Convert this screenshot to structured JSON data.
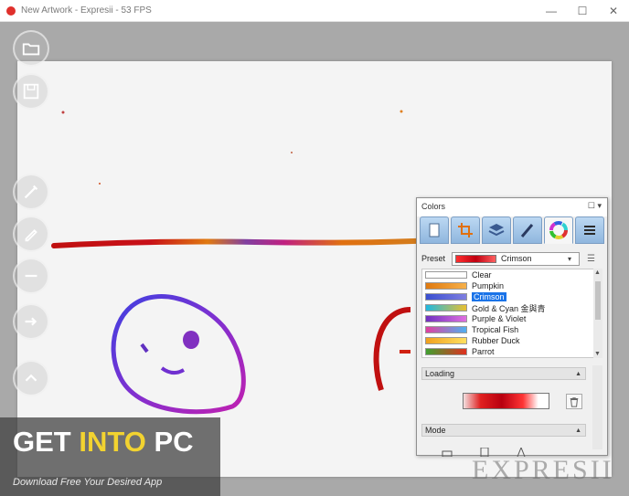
{
  "window": {
    "title": "New Artwork - Expresii - 53 FPS",
    "minimize_glyph": "—",
    "maximize_glyph": "☐",
    "close_glyph": "✕"
  },
  "tools": [
    {
      "name": "open-folder-icon"
    },
    {
      "name": "save-icon"
    },
    {
      "name": "brush-icon"
    },
    {
      "name": "pencil-icon"
    },
    {
      "name": "undo-icon"
    },
    {
      "name": "redo-icon"
    },
    {
      "name": "up-icon"
    }
  ],
  "colors_panel": {
    "title": "Colors",
    "menu_glyph": "☐ ▾",
    "tabs": [
      {
        "name": "tab-paper"
      },
      {
        "name": "tab-crop"
      },
      {
        "name": "tab-layers"
      },
      {
        "name": "tab-brushes"
      },
      {
        "name": "tab-colors"
      },
      {
        "name": "tab-menu"
      }
    ],
    "preset_label": "Preset",
    "preset_value": "Crimson",
    "presets": [
      {
        "label": "Clear",
        "gradient": [
          "#ffffff",
          "#ffffff"
        ]
      },
      {
        "label": "Pumpkin",
        "gradient": [
          "#e07a10",
          "#f6b04a"
        ]
      },
      {
        "label": "Crimson",
        "gradient": [
          "#3a4fd0",
          "#7f7fe0"
        ]
      },
      {
        "label": "Gold & Cyan 金與青",
        "gradient": [
          "#20b8e0",
          "#e9c030"
        ]
      },
      {
        "label": "Purple & Violet",
        "gradient": [
          "#7030c0",
          "#e070e0"
        ]
      },
      {
        "label": "Tropical Fish",
        "gradient": [
          "#e040a0",
          "#50b0f0"
        ]
      },
      {
        "label": "Rubber Duck",
        "gradient": [
          "#f0a020",
          "#ffe060"
        ]
      },
      {
        "label": "Parrot",
        "gradient": [
          "#40a030",
          "#e03020"
        ]
      }
    ],
    "selected_index": 2,
    "section_loading": "Loading",
    "section_mode": "Mode"
  },
  "watermark": {
    "title_white_1": "GET ",
    "title_yellow": "INTO",
    "title_white_2": " PC",
    "subtitle": "Download Free Your Desired App",
    "logo": "EXPRESII"
  }
}
